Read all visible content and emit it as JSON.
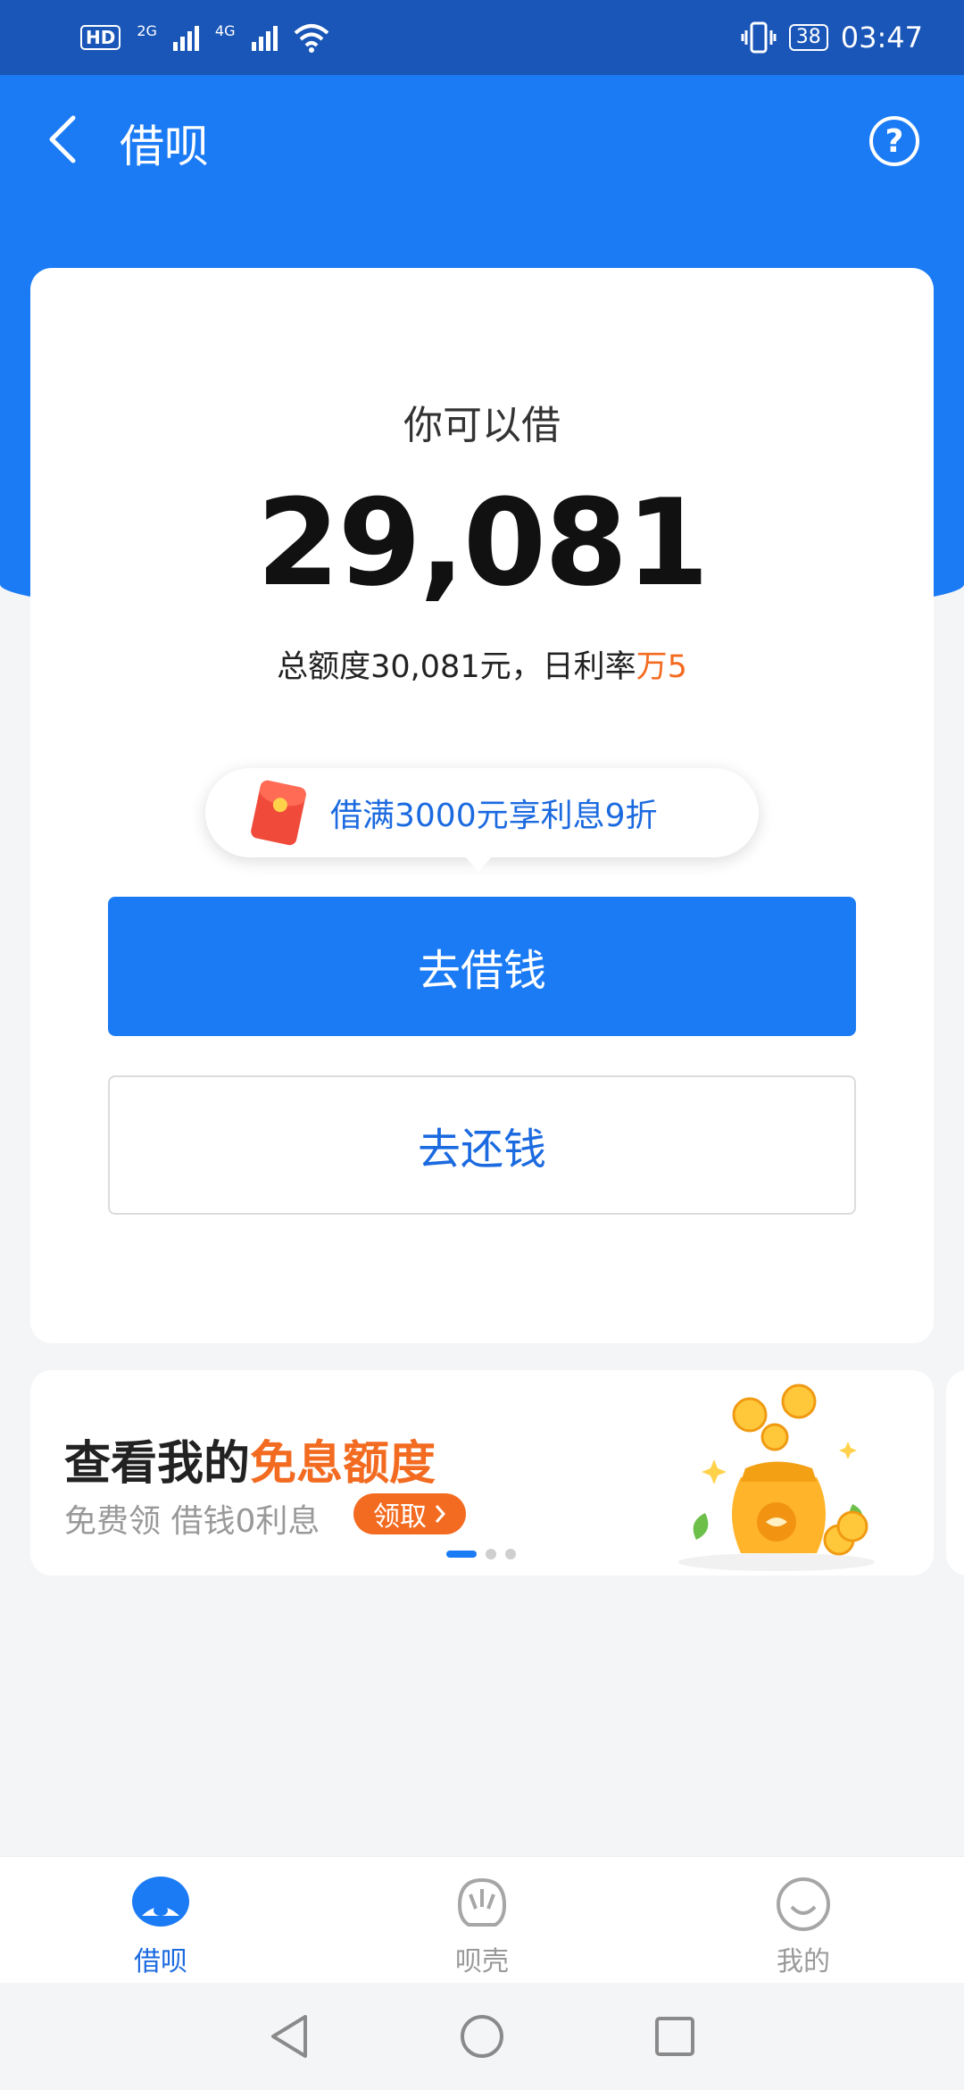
{
  "status_bar": {
    "hd": "HD",
    "sim1_net": "2G",
    "sim2_net": "4G",
    "battery": "38",
    "time": "03:47"
  },
  "header": {
    "title": "借呗",
    "back_icon": "back-chevron-icon",
    "help_icon": "question-circle-icon"
  },
  "main_card": {
    "label": "你可以借",
    "amount": "29,081",
    "limit_prefix": "总额度30,081元，日利率",
    "rate": "万5",
    "promo_text": "借满3000元享利息9折",
    "borrow_button": "去借钱",
    "repay_button": "去还钱"
  },
  "banner": {
    "title_prefix": "查看我的",
    "title_highlight": "免息额度",
    "subtitle": "免费领 借钱0利息",
    "claim_button": "领取",
    "dots": 3,
    "active_dot": 0,
    "colors": {
      "highlight": "#f36b21"
    }
  },
  "tab_bar": {
    "tabs": [
      {
        "label": "借呗",
        "icon": "jiebei-shell-icon",
        "active": true
      },
      {
        "label": "呗壳",
        "icon": "beike-shell-icon",
        "active": false
      },
      {
        "label": "我的",
        "icon": "smiley-icon",
        "active": false
      }
    ]
  },
  "colors": {
    "primary": "#1b7bf5",
    "accent": "#f36b21",
    "status_bar": "#1a56b8"
  }
}
